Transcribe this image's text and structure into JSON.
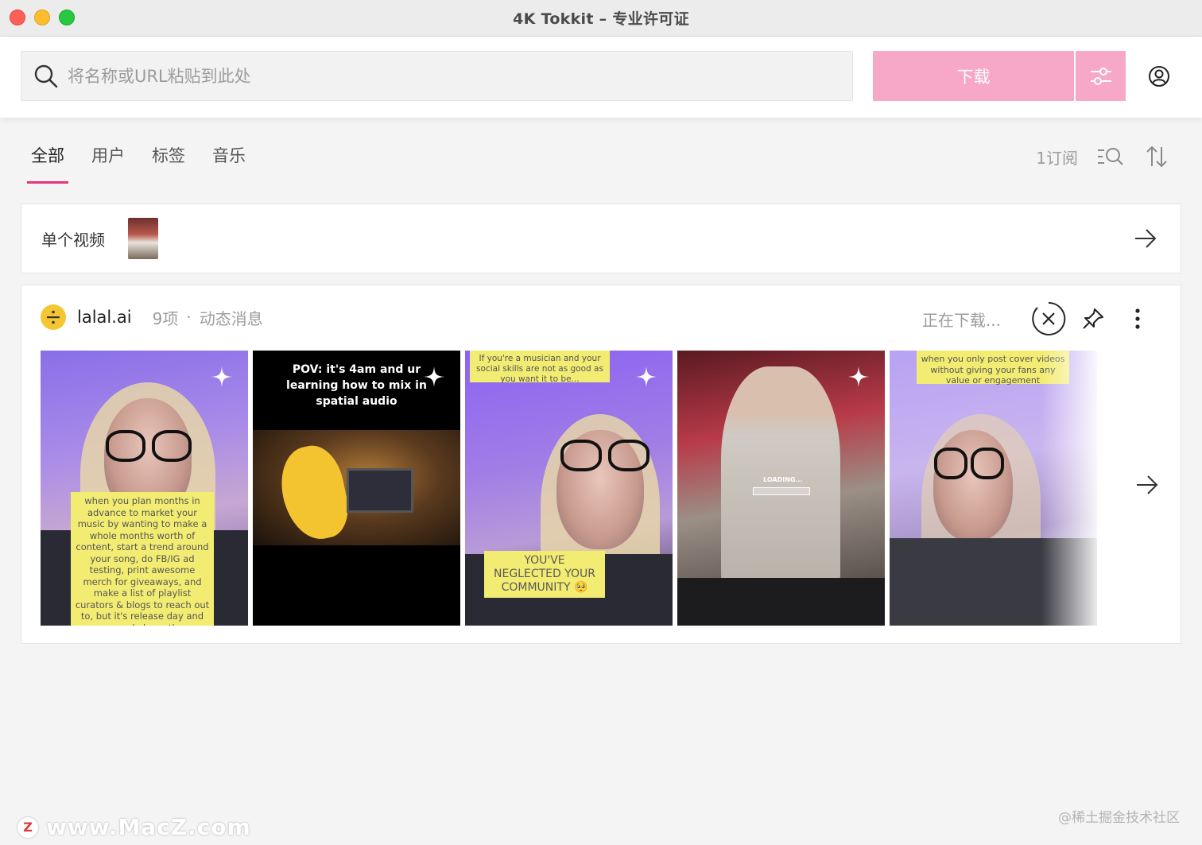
{
  "window": {
    "title": "4K Tokkit – 专业许可证"
  },
  "toolbar": {
    "search_placeholder": "将名称或URL粘贴到此处",
    "download_label": "下载",
    "settings_icon": "sliders-icon",
    "account_icon": "user-circle-icon"
  },
  "tabs": {
    "items": [
      {
        "label": "全部",
        "active": true
      },
      {
        "label": "用户",
        "active": false
      },
      {
        "label": "标签",
        "active": false
      },
      {
        "label": "音乐",
        "active": false
      }
    ],
    "subscriptions": "1订阅",
    "search_list_icon": "list-search-icon",
    "sort_icon": "sort-icon"
  },
  "single_video": {
    "label": "单个视频"
  },
  "channel": {
    "name": "lalal.ai",
    "count": "9项",
    "separator": "·",
    "type": "动态消息",
    "status": "正在下载...",
    "videos": [
      {
        "caption": "when you plan months in advance to market your music by wanting to make a whole months worth of content, start a trend around your song, do FB/IG ad testing, print awesome merch for giveaways, and make a list of playlist curators & blogs to reach out to, but it's release day and you only have the"
      },
      {
        "caption": "POV: it's 4am and ur learning how to mix in spatial audio"
      },
      {
        "caption_top": "If you're a musician and your social skills are not as good as you want it to be...",
        "caption_bottom": "YOU'VE NEGLECTED YOUR COMMUNITY 🥺"
      },
      {
        "caption": "LOADING..."
      },
      {
        "caption": "when you only post cover videos without giving your fans any value or engagement"
      }
    ]
  },
  "watermark": {
    "left_logo": "Z",
    "left_text": "www.MacZ.com",
    "right_text": "@稀土掘金技术社区"
  },
  "colors": {
    "accent": "#e8337e",
    "download_button": "#f7a8c8",
    "avatar": "#f4c632"
  }
}
